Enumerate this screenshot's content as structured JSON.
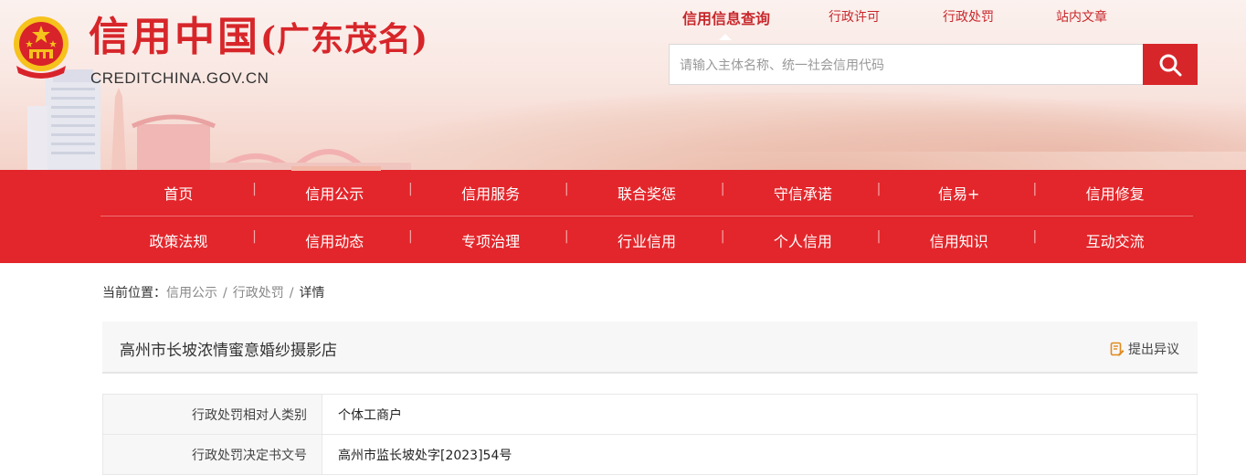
{
  "header": {
    "brand_cn": "信用中国",
    "brand_region": "(广东茂名)",
    "brand_en": "CREDITCHINA.GOV.CN",
    "topnav": [
      {
        "label": "信用信息查询",
        "active": true
      },
      {
        "label": "行政许可",
        "active": false
      },
      {
        "label": "行政处罚",
        "active": false
      },
      {
        "label": "站内文章",
        "active": false
      }
    ],
    "search": {
      "placeholder": "请输入主体名称、统一社会信用代码",
      "icon": "search-icon"
    }
  },
  "nav": {
    "row1": [
      "首页",
      "信用公示",
      "信用服务",
      "联合奖惩",
      "守信承诺",
      "信易+",
      "信用修复"
    ],
    "row2": [
      "政策法规",
      "信用动态",
      "专项治理",
      "行业信用",
      "个人信用",
      "信用知识",
      "互动交流"
    ],
    "active": "信用公示"
  },
  "breadcrumb": {
    "prefix": "当前位置：",
    "items": [
      "信用公示",
      "行政处罚"
    ],
    "current": "详情",
    "separator": "/"
  },
  "detail": {
    "title": "高州市长坡浓情蜜意婚纱摄影店",
    "objection_label": "提出异议",
    "objection_icon": "edit-document-icon",
    "rows": [
      {
        "label": "行政处罚相对人类别",
        "value": "个体工商户"
      },
      {
        "label": "行政处罚决定书文号",
        "value": "高州市监长坡处字[2023]54号"
      }
    ]
  },
  "colors": {
    "brand_red": "#e3262b",
    "title_red": "#d7262a"
  }
}
